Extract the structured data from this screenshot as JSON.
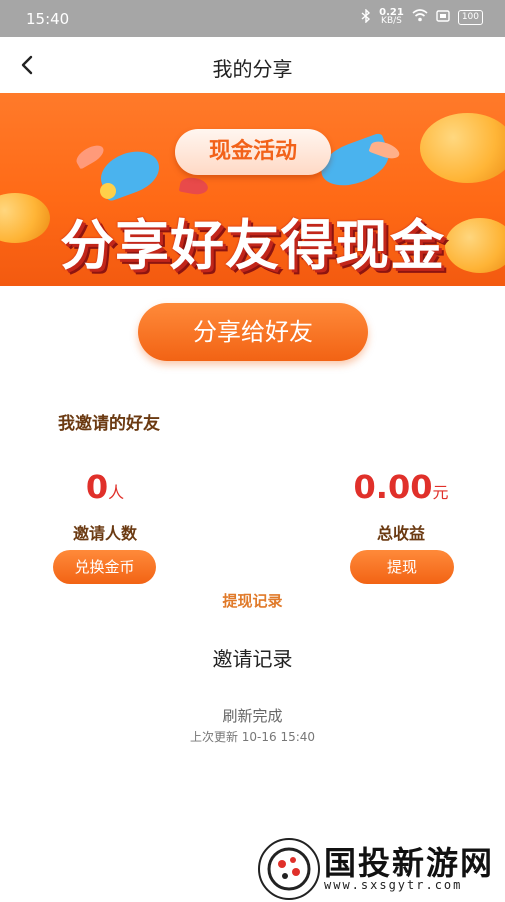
{
  "status_bar": {
    "time": "15:40",
    "speed_value": "0.21",
    "speed_unit": "KB/S",
    "battery": "100"
  },
  "navbar": {
    "title": "我的分享",
    "back_icon": "chevron-left-icon"
  },
  "banner": {
    "tag": "现金活动",
    "headline": "分享好友得现金"
  },
  "share_button": {
    "label": "分享给好友"
  },
  "invited_section": {
    "label": "我邀请的好友"
  },
  "stats": {
    "invite_count": {
      "value": "0",
      "unit": "人",
      "caption": "邀请人数",
      "button": "兑换金币"
    },
    "total_income": {
      "value": "0.00",
      "unit": "元",
      "caption": "总收益",
      "button": "提现"
    }
  },
  "withdraw_record_link": "提现记录",
  "invite_record": {
    "title": "邀请记录",
    "refresh_status": "刷新完成",
    "last_update": "上次更新 10-16 15:40"
  },
  "watermark": {
    "name": "国投新游网",
    "url": "www.sxsgytr.com"
  },
  "colors": {
    "accent": "#f26314",
    "value_red": "#e0302a",
    "label_brown": "#6b3a12",
    "link_orange": "#e07a2a"
  }
}
